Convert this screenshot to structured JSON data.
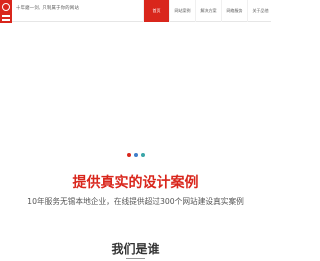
{
  "header": {
    "slogan": "十年磨一剑, 只制属于你的网站"
  },
  "nav": {
    "items": [
      {
        "label": "首页",
        "active": true
      },
      {
        "label": "网站案例",
        "active": false
      },
      {
        "label": "解决方案",
        "active": false
      },
      {
        "label": "网络服务",
        "active": false
      },
      {
        "label": "关于品他",
        "active": false
      }
    ]
  },
  "slider": {
    "dots": [
      {
        "color": "#d9261c"
      },
      {
        "color": "#3f7ec9"
      },
      {
        "color": "#3aa6a8"
      }
    ]
  },
  "cases": {
    "title": "提供真实的设计案例",
    "subtitle": "10年服务无锡本地企业，在线提供超过300个网站建设真实案例"
  },
  "about": {
    "title": "我们是谁"
  },
  "colors": {
    "accent": "#d9261c"
  }
}
